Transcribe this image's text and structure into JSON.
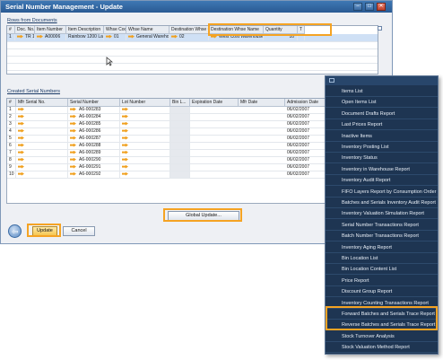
{
  "window": {
    "title": "Serial Number Management - Update",
    "controls": [
      "‒",
      "□",
      "✕"
    ]
  },
  "rows_from_documents": {
    "label": "Rows from Documents",
    "columns": [
      "#",
      "Doc. No.",
      "Item Number",
      "Item Description",
      "Whse Code",
      "Whse Name",
      "Destination Whse Code",
      "Destination Whse Name",
      "Quantity",
      "T"
    ],
    "rows": [
      {
        "num": "1",
        "doc_no": "TR 14",
        "item_number": "A00006",
        "description": "Rainbow 1200 Laser",
        "whse_code": "01",
        "whse_name": "General Warehouse",
        "dest_code": "02",
        "dest_name": "West Cost Warehouse",
        "quantity": "10",
        "t": ""
      }
    ]
  },
  "created_serials": {
    "label": "Created Serial Numbers",
    "columns": [
      "#",
      "Mfr Serial No.",
      "Serial Number",
      "Lot Number",
      "Bin L...",
      "Expiration Date",
      "Mfr Date",
      "Admission Date"
    ],
    "rows": [
      {
        "num": "1",
        "serial": "A6-000283",
        "admission": "06/02/2007"
      },
      {
        "num": "2",
        "serial": "A6-000284",
        "admission": "06/02/2007"
      },
      {
        "num": "3",
        "serial": "A6-000285",
        "admission": "06/02/2007"
      },
      {
        "num": "4",
        "serial": "A6-000286",
        "admission": "06/02/2007"
      },
      {
        "num": "5",
        "serial": "A6-000287",
        "admission": "06/02/2007"
      },
      {
        "num": "6",
        "serial": "A6-000288",
        "admission": "06/02/2007"
      },
      {
        "num": "7",
        "serial": "A6-000289",
        "admission": "06/02/2007"
      },
      {
        "num": "8",
        "serial": "A6-000290",
        "admission": "06/02/2007"
      },
      {
        "num": "9",
        "serial": "A6-000291",
        "admission": "06/02/2007"
      },
      {
        "num": "10",
        "serial": "A6-000292",
        "admission": "06/02/2007"
      }
    ]
  },
  "buttons": {
    "global_update": "Global Update...",
    "update": "Update",
    "cancel": "Cancel"
  },
  "menu": {
    "items": [
      "Items List",
      "Open Items List",
      "Document Drafts Report",
      "Last Prices Report",
      "Inactive Items",
      "Inventory Posting List",
      "Inventory Status",
      "Inventory in Warehouse Report",
      "Inventory Audit Report",
      "FIFO Layers Report by Consumption Order",
      "Batches and Serials Inventory Audit Report",
      "Inventory Valuation Simulation Report",
      "Serial Number Transactions Report",
      "Batch Number Transactions Report",
      "Inventory Aging Report",
      "Bin Location List",
      "Bin Location Content List",
      "Price Report",
      "Discount Group Report",
      "Inventory Counting Transactions Report",
      "Forward Batches and Serials Trace Report",
      "Reverse Batches and Serials Trace Report",
      "Stock Turnover Analysis",
      "Stock Valuation Method Report"
    ]
  },
  "colors": {
    "highlight": "#f5a323",
    "menu_bg": "#1e3552",
    "title_bar": "#2a5a93"
  }
}
